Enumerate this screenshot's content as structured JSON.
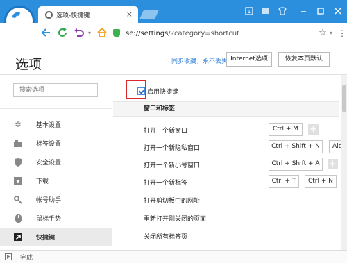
{
  "browser": {
    "tab_title": "选项-快捷键",
    "tab_close": "×",
    "address_host": "se://settings",
    "address_path": "/?category=shortcut",
    "colors": {
      "chrome": "#2b8fde",
      "secure": "#3bb24a",
      "refresh": "#2fa84f",
      "undo": "#8b3fb5",
      "home": "#f0a020"
    }
  },
  "header": {
    "title": "选项",
    "sync_link": "同步收藏，永不丢失",
    "internet_options": "Internet选项",
    "restore_defaults": "恢复本页默认"
  },
  "sidebar": {
    "search_placeholder": "搜索选项",
    "items": [
      {
        "icon": "gear-icon",
        "label": "基本设置"
      },
      {
        "icon": "tab-icon",
        "label": "标签设置"
      },
      {
        "icon": "shield-icon",
        "label": "安全设置"
      },
      {
        "icon": "download-icon",
        "label": "下载"
      },
      {
        "icon": "key-icon",
        "label": "帐号助手"
      },
      {
        "icon": "mouse-icon",
        "label": "鼠标手势"
      },
      {
        "icon": "shortcut-icon",
        "label": "快捷键",
        "active": true
      }
    ]
  },
  "content": {
    "enable_label": "启用快捷键",
    "enable_checked": true,
    "section_title": "窗口和标签",
    "shortcuts": [
      {
        "label": "打开一个新窗口",
        "keys": [
          "Ctrl + M"
        ]
      },
      {
        "label": "打开一个新隐私窗口",
        "keys": [
          "Ctrl + Shift + N",
          "Alt"
        ]
      },
      {
        "label": "打开一个新小号窗口",
        "keys": [
          "Ctrl + Shift + A"
        ]
      },
      {
        "label": "打开一个新标签",
        "keys": [
          "Ctrl + T",
          "Ctrl + N"
        ]
      },
      {
        "label": "打开剪切板中的网址",
        "keys": []
      },
      {
        "label": "重新打开刚关闭的页面",
        "keys": []
      },
      {
        "label": "关闭所有标签页",
        "keys": []
      }
    ]
  },
  "status": {
    "text": "完成"
  }
}
